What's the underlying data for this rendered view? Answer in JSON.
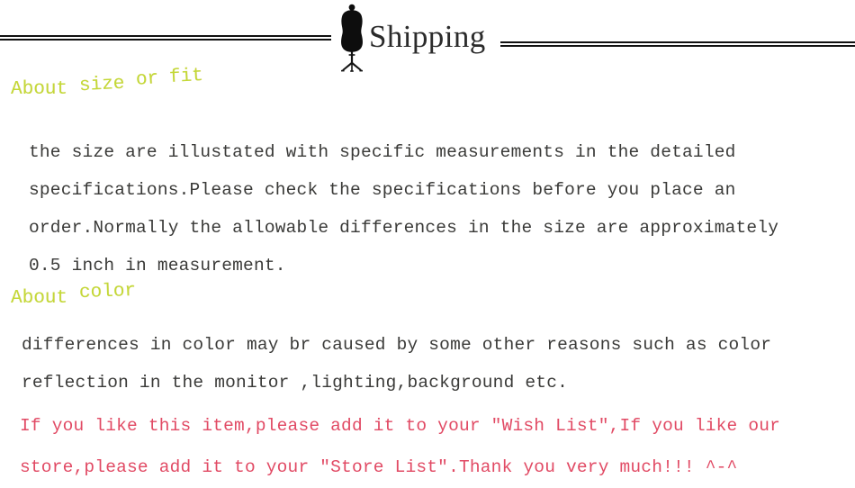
{
  "header": {
    "title": "Shipping",
    "icon": "dress-form-mannequin-icon",
    "rule_color": "#111111",
    "title_color": "#2b2b2b"
  },
  "sections": [
    {
      "heading_words": [
        "About",
        "size",
        "or",
        "fit"
      ],
      "heading_color": "#c3d936",
      "lines": [
        "the size are illustated with specific measurements in the detailed",
        "specifications.Please check the specifications before you place an",
        "order.Normally the allowable differences in the size are approximately",
        "0.5 inch in measurement."
      ]
    },
    {
      "heading_words": [
        "About",
        "color"
      ],
      "heading_color": "#c3d936",
      "lines": [
        "differences in color may br caused by some other reasons such as color",
        "reflection in the monitor ,lighting,background etc."
      ]
    }
  ],
  "note": {
    "color": "#e14a64",
    "lines": [
      "If you like this item,please add it to your \"Wish List\",If you like our",
      "store,please add it to your \"Store List\".Thank you very much!!! ^-^"
    ]
  }
}
